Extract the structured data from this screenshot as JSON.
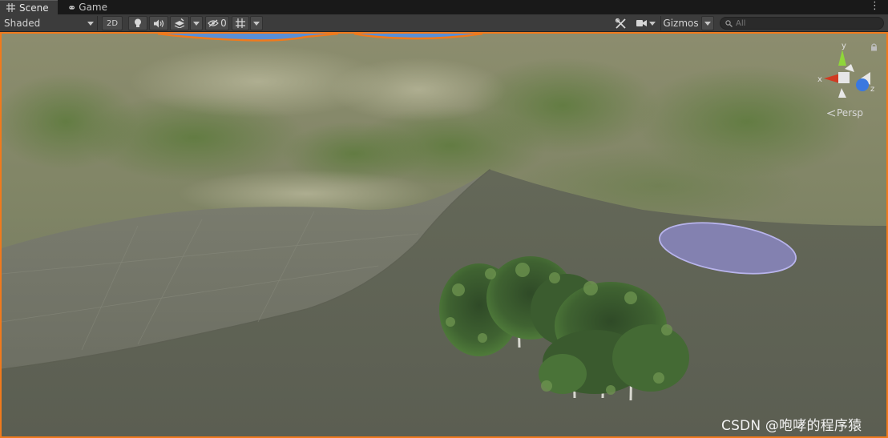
{
  "tabs": [
    {
      "label": "Scene",
      "icon": "grid-icon",
      "active": true
    },
    {
      "label": "Game",
      "icon": "gamepad-icon",
      "active": false
    }
  ],
  "toolbar": {
    "draw_mode": "Shaded",
    "two_d_label": "2D",
    "hidden_count": "0",
    "gizmos_label": "Gizmos",
    "search_placeholder": "All"
  },
  "scene": {
    "orientation": {
      "y_label": "y",
      "x_label": "x",
      "z_label": "z"
    },
    "projection_label": "Persp",
    "watermark": "CSDN @咆哮的程序猿"
  },
  "colors": {
    "selection_outline": "#f07a1c",
    "toolbar_bg": "#3c3c3c",
    "tab_bg": "#191919",
    "axis_x": "#d03a22",
    "axis_y": "#8fd63a",
    "axis_z": "#3a78e0",
    "water_disc": "#8a86c0"
  }
}
